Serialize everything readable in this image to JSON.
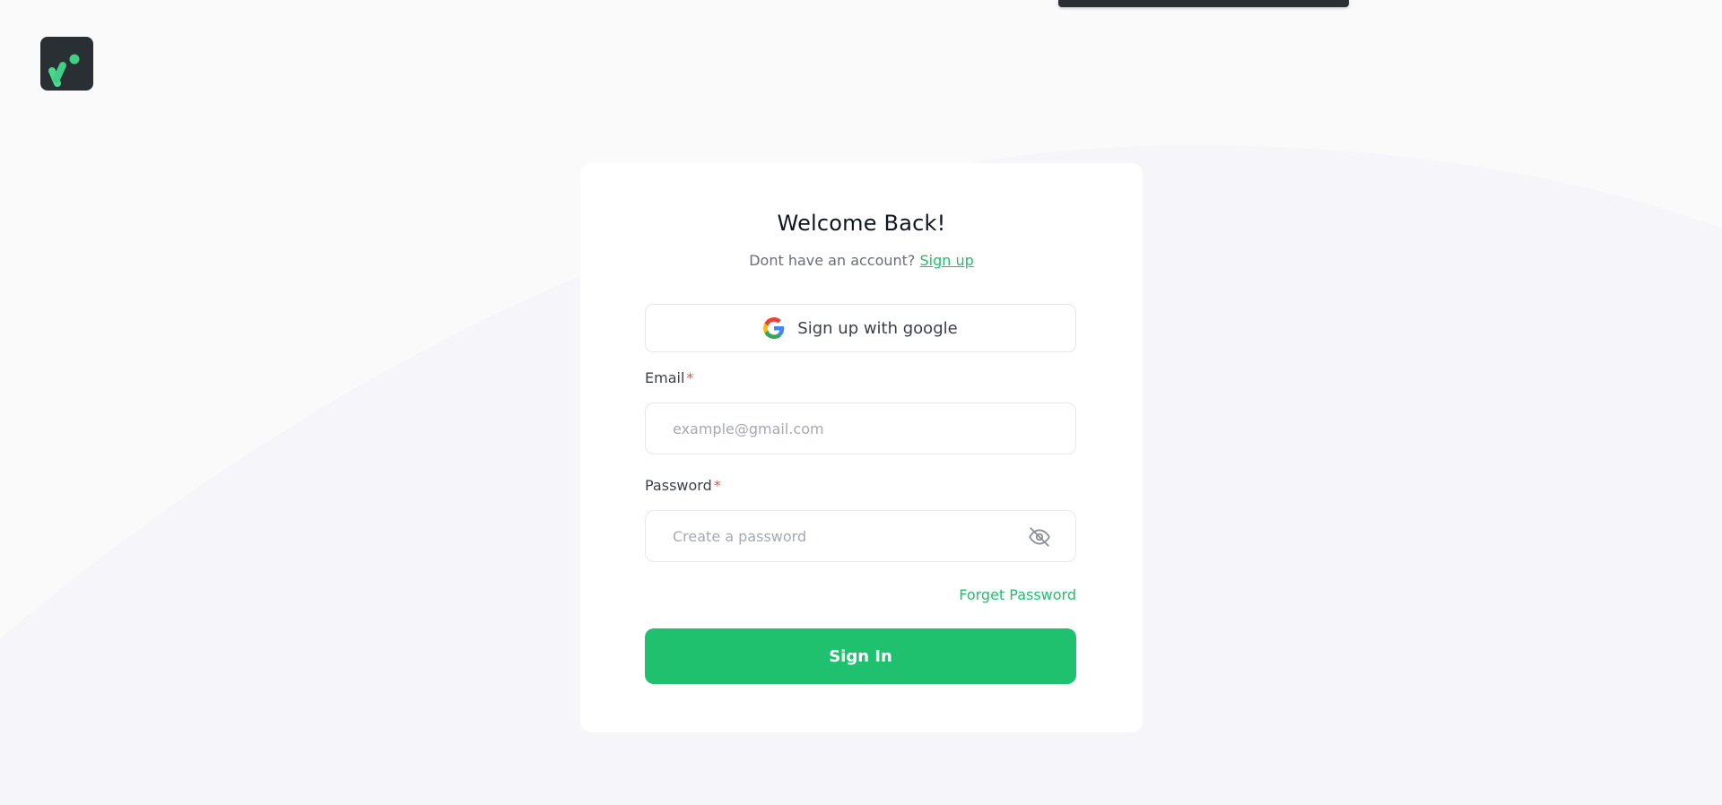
{
  "colors": {
    "accent": "#1fc16f",
    "background": "#fafafb",
    "card": "#ffffff",
    "logo_bg": "#2a2f33"
  },
  "logo": {
    "icon": "brand-logo-icon"
  },
  "card": {
    "title": "Welcome Back!",
    "subtitle_text": "Dont have an account?",
    "signup_link": "Sign up",
    "google_button_label": "Sign up with google",
    "email": {
      "label": "Email",
      "required_mark": "*",
      "placeholder": "example@gmail.com",
      "value": ""
    },
    "password": {
      "label": "Password",
      "required_mark": "*",
      "placeholder": "Create a password",
      "value": "",
      "toggle_icon": "eye-off-icon"
    },
    "forgot_link": "Forget Password",
    "signin_button_label": "Sign In"
  }
}
